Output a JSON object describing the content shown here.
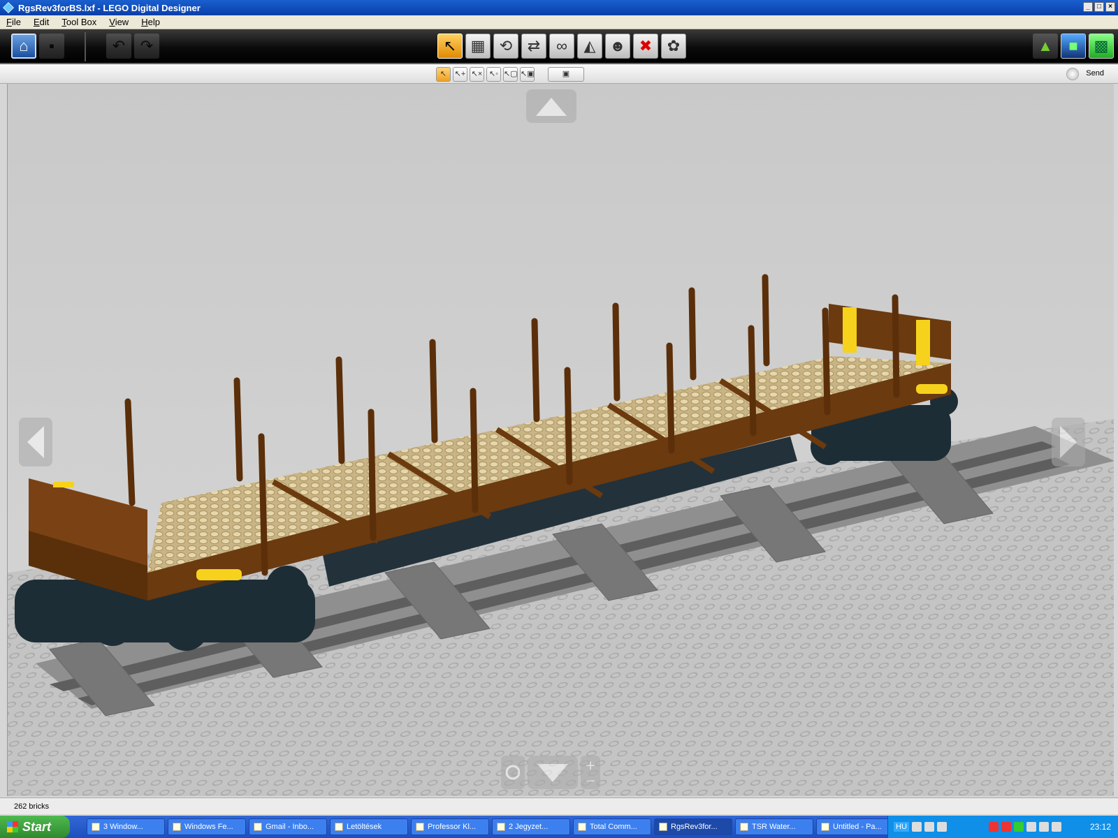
{
  "window": {
    "title": "RgsRev3forBS.lxf - LEGO Digital Designer"
  },
  "menu": [
    {
      "key": "F",
      "rest": "ile"
    },
    {
      "key": "E",
      "rest": "dit"
    },
    {
      "key": "T",
      "rest": "ool Box"
    },
    {
      "key": "V",
      "rest": "iew"
    },
    {
      "key": "H",
      "rest": "elp"
    }
  ],
  "toolbar": {
    "icons": [
      "home-icon",
      "save-icon",
      "undo-icon",
      "redo-icon",
      "select-icon",
      "clone-icon",
      "hinge-icon",
      "hinge-align-icon",
      "flex-icon",
      "paint-icon",
      "hide-icon",
      "delete-icon",
      "color-picker-icon",
      "mode-build-icon",
      "mode-view-icon",
      "mode-instructions-icon"
    ]
  },
  "subtoolbar": {
    "buttons": [
      "↖",
      "↖+",
      "↖×",
      "↖◦",
      "↖▢",
      "↖▣"
    ],
    "send_label": "Send"
  },
  "viewport": {
    "colors": {
      "background": "#cfcfcf",
      "baseplate": "#bdbdbd",
      "wagon_brown": "#6b3a0f",
      "deck_tan": "#d8c69a",
      "bogie": "#1d2d36",
      "accent_yellow": "#f6d21c",
      "track": "#8d8d8d"
    }
  },
  "status": {
    "brick_count": "262 bricks"
  },
  "taskbar": {
    "start": "Start",
    "items": [
      {
        "label": "3 Window...",
        "active": false
      },
      {
        "label": "Windows Fe...",
        "active": false
      },
      {
        "label": "Gmail - Inbo...",
        "active": false
      },
      {
        "label": "Letöltések",
        "active": false
      },
      {
        "label": "Professor Kl...",
        "active": false
      },
      {
        "label": "2 Jegyzet...",
        "active": false
      },
      {
        "label": "Total Comm...",
        "active": false
      },
      {
        "label": "RgsRev3for...",
        "active": true
      },
      {
        "label": "TSR Water...",
        "active": false
      },
      {
        "label": "Untitled - Pa...",
        "active": false
      }
    ],
    "lang": "HU",
    "clock": "23:12"
  }
}
